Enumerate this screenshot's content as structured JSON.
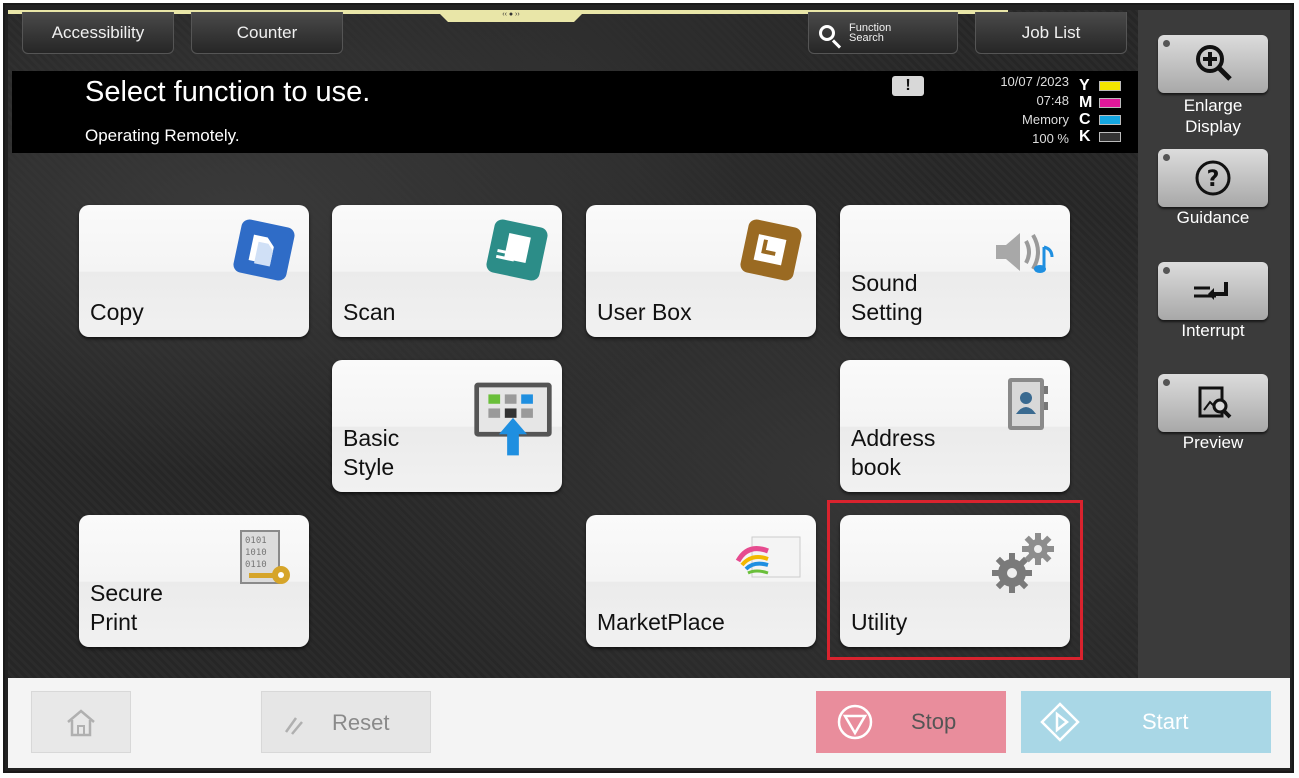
{
  "top_buttons": {
    "accessibility": "Accessibility",
    "counter": "Counter",
    "function_search_line1": "Function",
    "function_search_line2": "Search",
    "job_list": "Job List"
  },
  "header": {
    "title": "Select function to use.",
    "subtitle": "Operating Remotely.",
    "warning_symbol": "!",
    "date": "10/07 /2023",
    "time": "07:48",
    "memory_label": "Memory",
    "memory_value": "100 %"
  },
  "toner": [
    {
      "letter": "Y",
      "color": "#f2e600"
    },
    {
      "letter": "M",
      "color": "#e0189a"
    },
    {
      "letter": "C",
      "color": "#14a6e0"
    },
    {
      "letter": "K",
      "color": "#222222"
    }
  ],
  "tiles": {
    "copy": "Copy",
    "scan": "Scan",
    "user_box": "User Box",
    "sound_setting": "Sound\nSetting",
    "basic_style": "Basic\nStyle",
    "address_book": "Address\nbook",
    "secure_print": "Secure\nPrint",
    "marketplace": "MarketPlace",
    "utility": "Utility"
  },
  "sidebar": {
    "enlarge_display": "Enlarge\nDisplay",
    "guidance": "Guidance",
    "interrupt": "Interrupt",
    "preview": "Preview"
  },
  "bottom": {
    "reset": "Reset",
    "stop": "Stop",
    "start": "Start"
  },
  "colors": {
    "highlight": "#d9232e",
    "stop_button": "#e98d9c",
    "start_button": "#a9d7e6",
    "copy_icon": "#2f6cc7",
    "scan_icon": "#2c8d88",
    "user_box_icon": "#9a6a22"
  }
}
